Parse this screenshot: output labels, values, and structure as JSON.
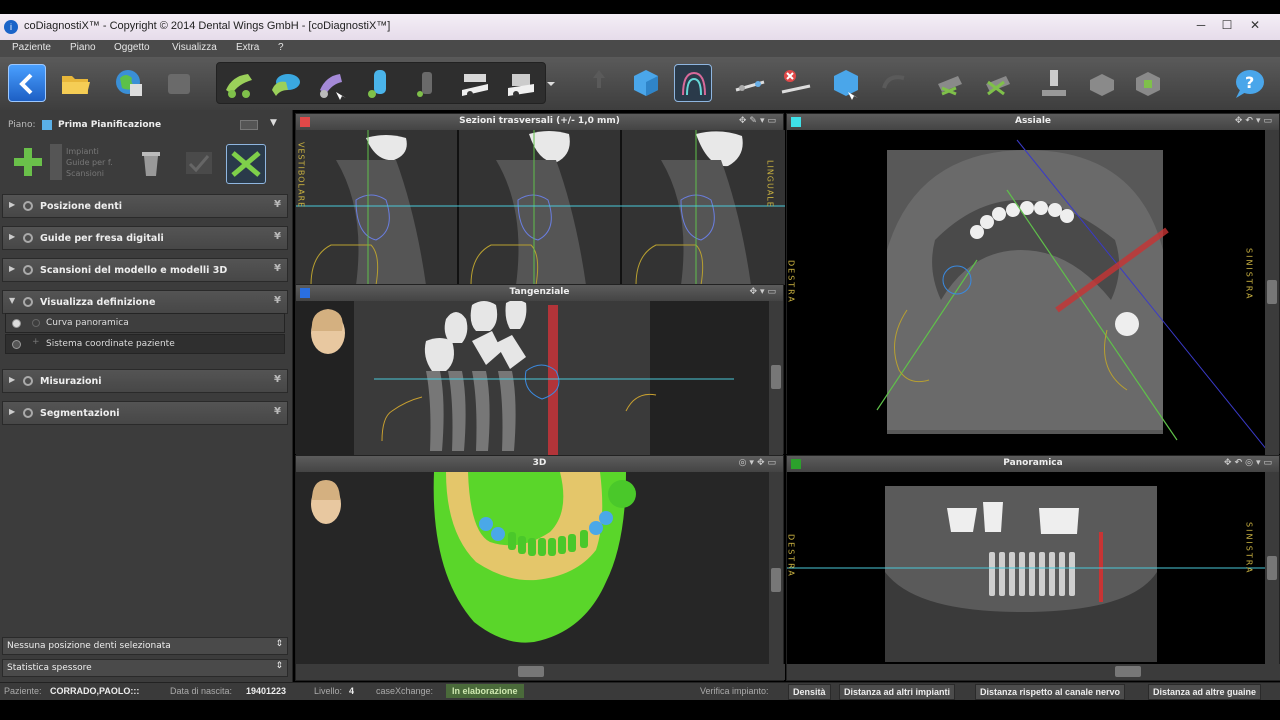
{
  "window": {
    "title": "coDiagnostiX™ - Copyright © 2014 Dental Wings GmbH - [coDiagnostiX™]",
    "minimize": "─",
    "maximize": "☐",
    "close": "✕"
  },
  "menu": [
    "Paziente",
    "Piano",
    "Oggetto",
    "Visualizza",
    "Extra",
    "?"
  ],
  "toolbar": {
    "icons": [
      "back-icon",
      "open-folder-icon",
      "globe-icon",
      "export-icon",
      "implant-tool-1-icon",
      "implant-tool-2-icon",
      "implant-tool-3-icon",
      "implant-cylinder-icon",
      "implant-gray-icon",
      "sleeve-tool-1-icon",
      "sleeve-tool-2-icon",
      "move-icon",
      "cube-view-icon",
      "panoramic-curve-icon",
      "measure-distance-icon",
      "delete-measure-icon",
      "cube-3d-icon",
      "undo-icon",
      "guide-tool-1-icon",
      "guide-tool-2-icon",
      "scan-body-icon",
      "export-guide-icon",
      "shield-icon",
      "help-icon"
    ]
  },
  "left_panel": {
    "plan_label": "Piano:",
    "plan_value": "Prima Pianificazione",
    "tools": [
      "Impianti",
      "Guide per f.",
      "Scansioni"
    ],
    "sections": [
      {
        "label": "Posizione denti",
        "expanded": false
      },
      {
        "label": "Guide per fresa digitali",
        "expanded": false
      },
      {
        "label": "Scansioni del modello e modelli 3D",
        "expanded": false
      },
      {
        "label": "Visualizza definizione",
        "expanded": true
      },
      {
        "label": "Misurazioni",
        "expanded": false
      },
      {
        "label": "Segmentazioni",
        "expanded": false
      }
    ],
    "sub_items": [
      "Curva panoramica",
      "Sistema coordinate paziente"
    ],
    "bottom": [
      "Nessuna posizione denti selezionata",
      "Statistica spessore"
    ]
  },
  "views": {
    "cross": {
      "title": "Sezioni trasversali (+/- 1,0 mm)",
      "color": "#e04848",
      "left_label": "VESTIBOLARE",
      "right_label": "LINGUALE"
    },
    "tangential": {
      "title": "Tangenziale",
      "color": "#2a6fe0"
    },
    "d3": {
      "title": "3D"
    },
    "axial": {
      "title": "Assiale",
      "color": "#3fe0e8",
      "left_label": "DESTRA",
      "right_label": "SINISTRA"
    },
    "panoramic": {
      "title": "Panoramica",
      "color": "#2ca02c",
      "left_label": "DESTRA",
      "right_label": "SINISTRA"
    }
  },
  "status": {
    "patient_label": "Paziente:",
    "patient_value": "CORRADO,PAOLO:::",
    "dob_label": "Data di nascita:",
    "dob_value": "19401223",
    "level_label": "Livello:",
    "level_value": "4",
    "casex_label": "caseXchange:",
    "casex_value": "In elaborazione",
    "verify_label": "Verifica impianto:",
    "buttons": [
      "Densità",
      "Distanza ad altri impianti",
      "Distanza rispetto al canale nervo",
      "Distanza ad altre guaine"
    ]
  }
}
